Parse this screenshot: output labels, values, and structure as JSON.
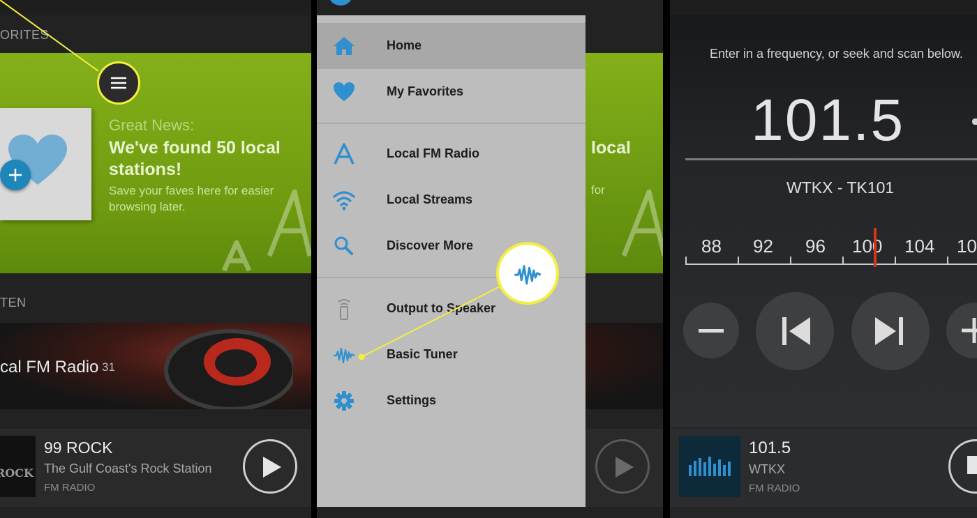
{
  "left_screen": {
    "favorites_header": "ORITES",
    "promo": {
      "kicker": "Great News:",
      "headline": "We've found 50 local stations!",
      "subtext": "Save your faves here for easier browsing later."
    },
    "listen_header": "TEN",
    "featured": {
      "title": "cal FM Radio",
      "count": "31"
    },
    "now_playing": {
      "logo_text": "ROCK",
      "station": "99 ROCK",
      "tagline": "The Gulf Coast's Rock Station",
      "type": "FM RADIO"
    }
  },
  "drawer": {
    "items": [
      {
        "label": "Home",
        "icon": "home-icon"
      },
      {
        "label": "My Favorites",
        "icon": "heart-icon"
      },
      {
        "label": "Local FM Radio",
        "icon": "antenna-icon"
      },
      {
        "label": "Local Streams",
        "icon": "wifi-icon"
      },
      {
        "label": "Discover More",
        "icon": "search-icon"
      },
      {
        "label": "Output to Speaker",
        "icon": "speaker-icon"
      },
      {
        "label": "Basic Tuner",
        "icon": "waveform-icon"
      },
      {
        "label": "Settings",
        "icon": "gear-icon"
      }
    ]
  },
  "middle_bg": {
    "headline_fragment": "local",
    "subtext_fragment": "for"
  },
  "tuner": {
    "instructions": "Enter in a frequency, or seek and scan below.",
    "frequency": "101.5",
    "station": "WTKX - TK101",
    "dial_labels": [
      "88",
      "92",
      "96",
      "100",
      "104",
      "10"
    ],
    "needle_value": 101.5
  },
  "tuner_now_playing": {
    "frequency": "101.5",
    "call": "WTKX",
    "type": "FM RADIO"
  },
  "colors": {
    "accent_blue": "#2f8fcf",
    "promo_green": "#7aa614",
    "highlight_yellow": "#f4ee40",
    "needle_red": "#d8331c",
    "drawer_bg": "#bdbdbd"
  }
}
